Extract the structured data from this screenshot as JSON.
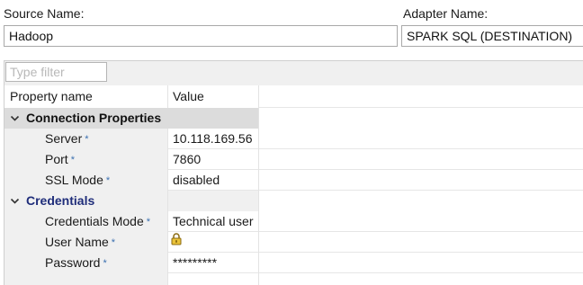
{
  "source": {
    "label": "Source Name:",
    "value": "Hadoop"
  },
  "adapter": {
    "label": "Adapter Name:",
    "value": "SPARK SQL (DESTINATION)"
  },
  "filter": {
    "placeholder": "Type filter"
  },
  "table": {
    "headers": {
      "name": "Property name",
      "value": "Value"
    },
    "groups": [
      {
        "title": "Connection Properties",
        "title_color": "#111111",
        "rows": [
          {
            "name": "Server",
            "required": "*",
            "value": "10.118.169.56"
          },
          {
            "name": "Port",
            "required": "*",
            "value": "7860"
          },
          {
            "name": "SSL Mode",
            "required": "*",
            "value": "disabled"
          }
        ]
      },
      {
        "title": "Credentials",
        "title_color": "#1f2d7a",
        "rows": [
          {
            "name": "Credentials Mode",
            "required": "*",
            "value": "Technical user"
          },
          {
            "name": "User Name",
            "required": "*",
            "value": "",
            "icon": "lock-icon"
          },
          {
            "name": "Password",
            "required": "*",
            "value": "*********"
          }
        ]
      }
    ]
  }
}
